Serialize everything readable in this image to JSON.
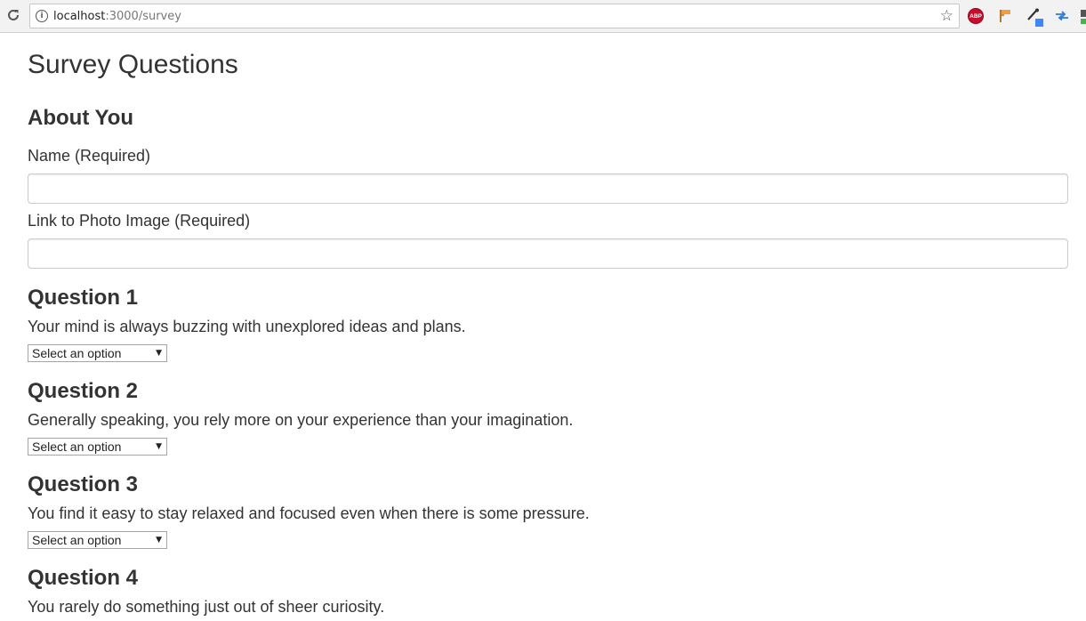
{
  "browser": {
    "url_host": "localhost",
    "url_path": ":3000/survey",
    "extensions": [
      "adblock-plus-icon",
      "flag-icon",
      "color-picker-icon",
      "arrows-icon",
      "partial-extension-icon"
    ],
    "abp_label": "ABP"
  },
  "page": {
    "title": "Survey Questions",
    "about_heading": "About You",
    "name_label": "Name (Required)",
    "name_value": "",
    "photo_label": "Link to Photo Image (Required)",
    "photo_value": ""
  },
  "questions": [
    {
      "title": "Question 1",
      "text": "Your mind is always buzzing with unexplored ideas and plans.",
      "select_value": "Select an option"
    },
    {
      "title": "Question 2",
      "text": "Generally speaking, you rely more on your experience than your imagination.",
      "select_value": "Select an option"
    },
    {
      "title": "Question 3",
      "text": "You find it easy to stay relaxed and focused even when there is some pressure.",
      "select_value": "Select an option"
    },
    {
      "title": "Question 4",
      "text": "You rarely do something just out of sheer curiosity."
    }
  ],
  "colors": {
    "text": "#333333",
    "chrome_bg": "#f2f2f2",
    "abp_red": "#c70d2c",
    "picker_blue": "#4285f4"
  }
}
